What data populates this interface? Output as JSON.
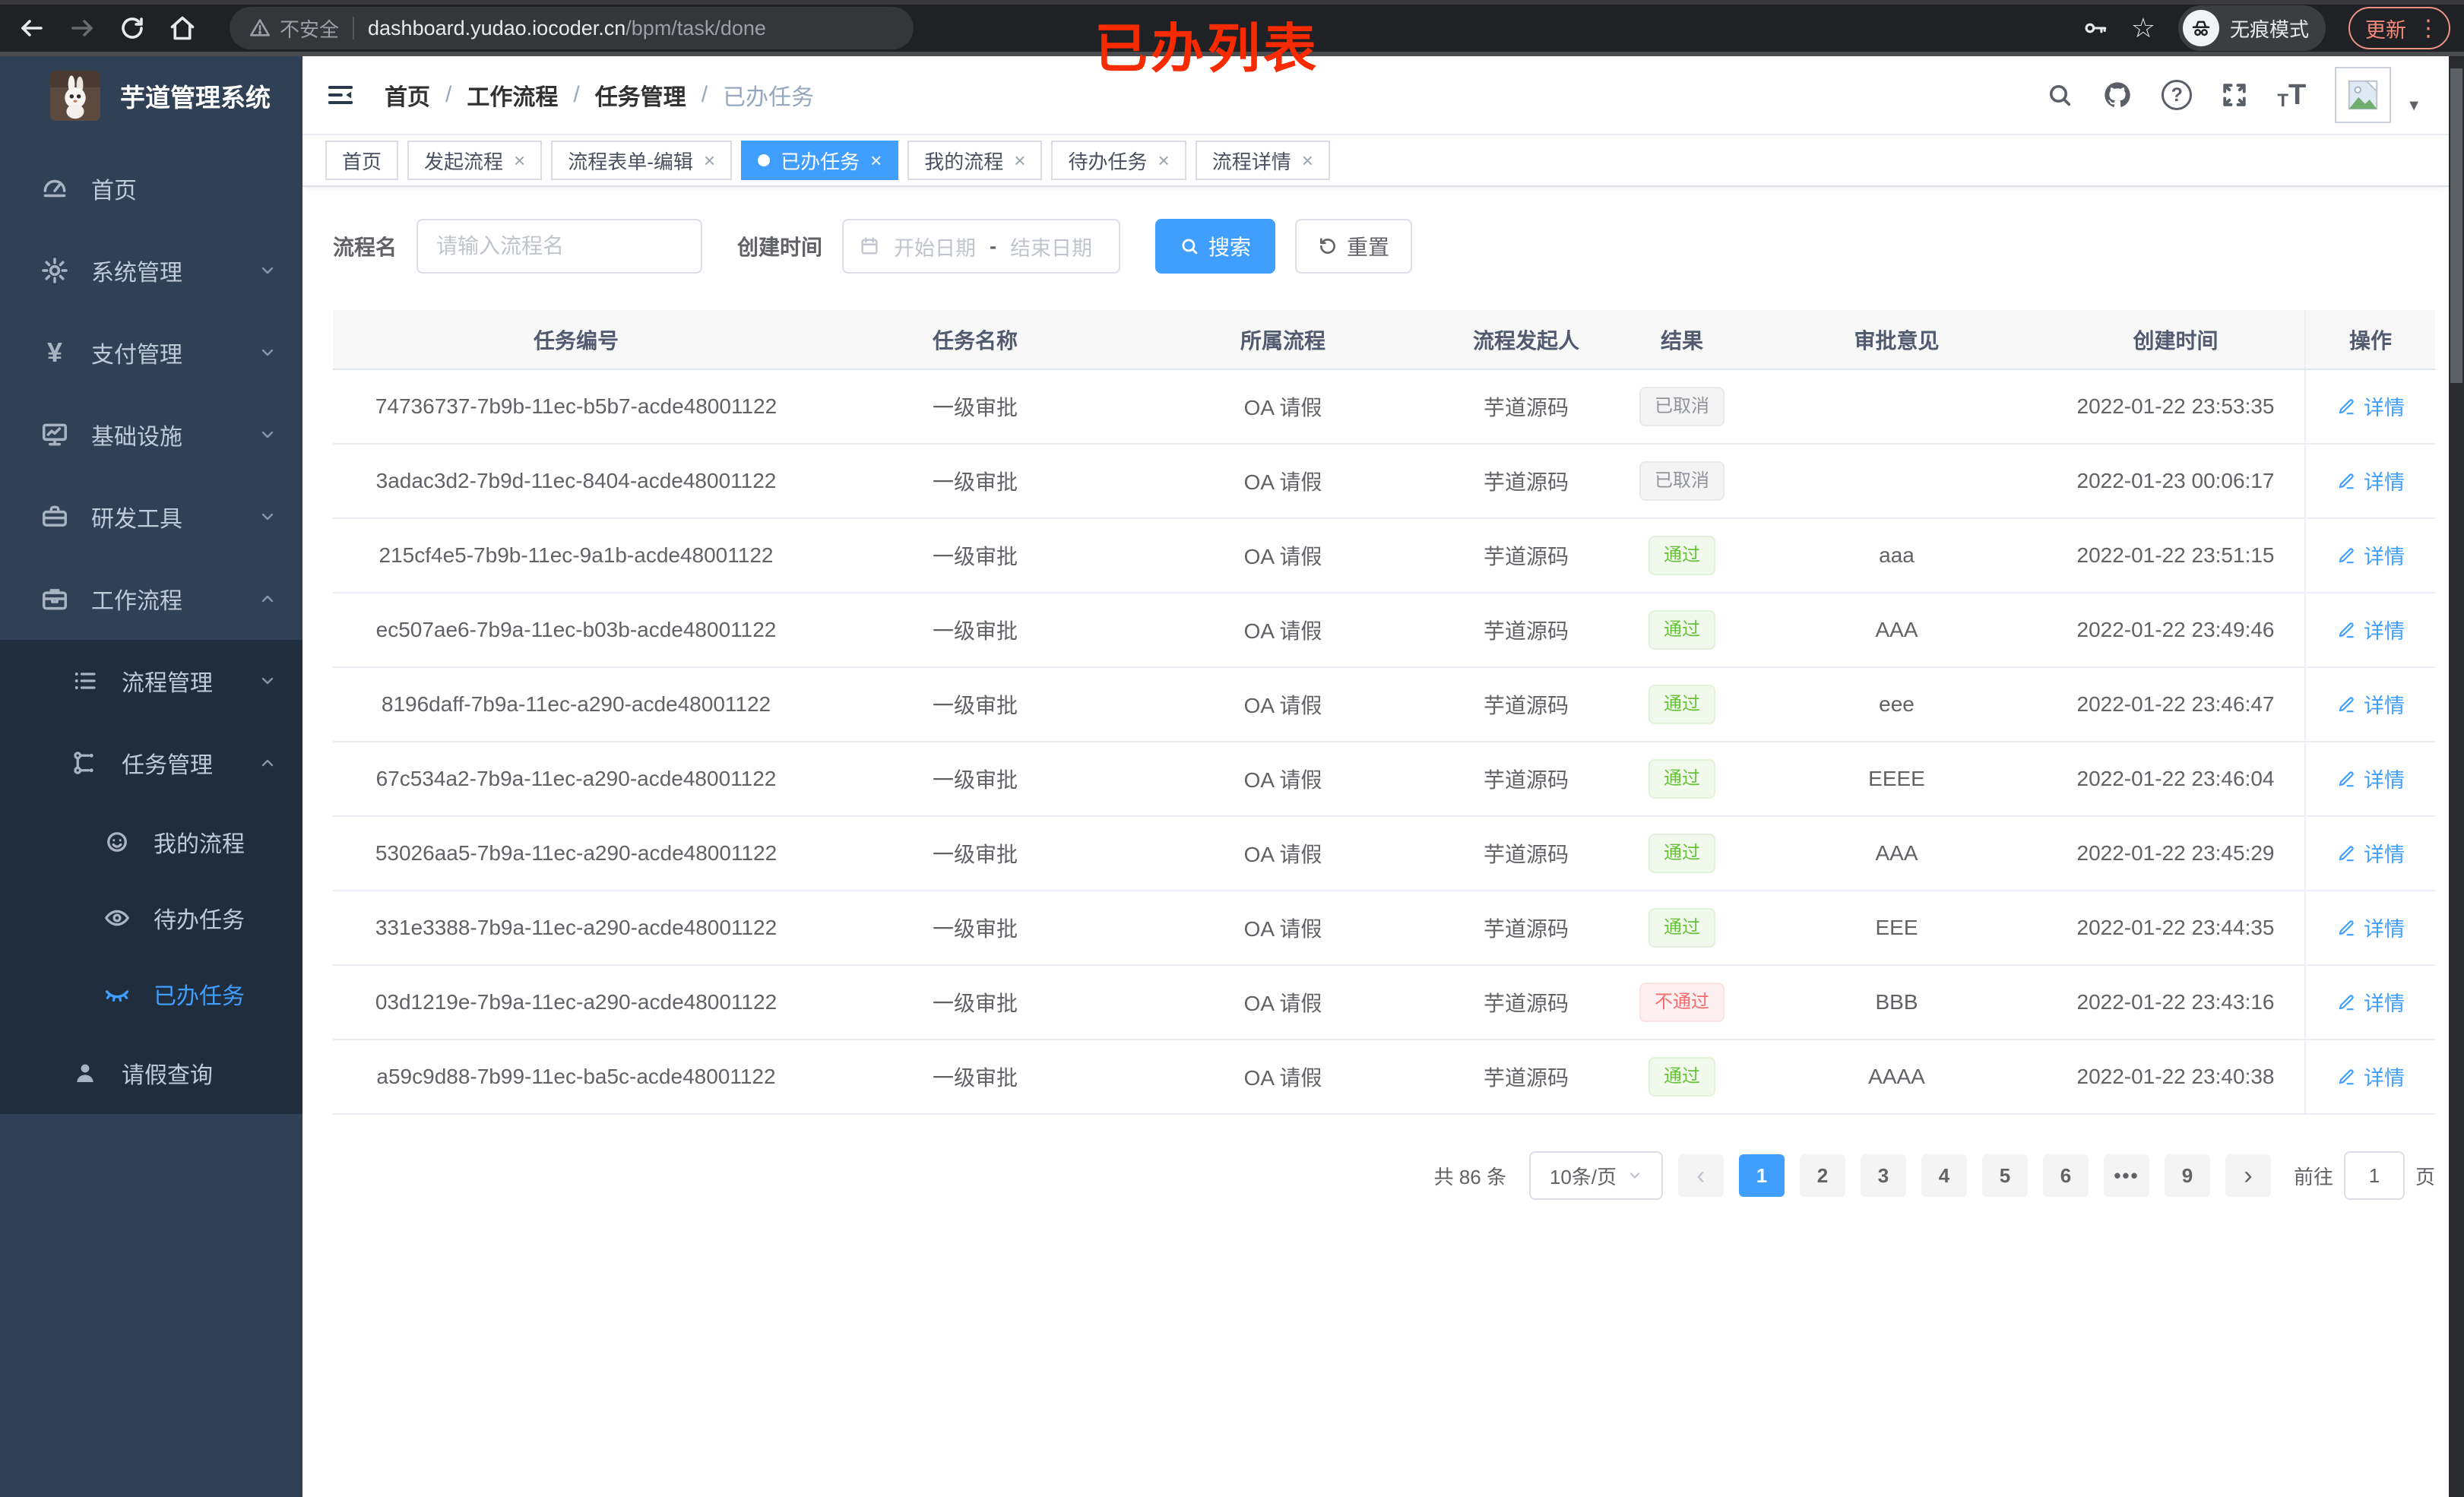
{
  "browser": {
    "security_label": "不安全",
    "url_host": "dashboard.yudao.iocoder.cn",
    "url_path": "/bpm/task/done",
    "incognito_label": "无痕模式",
    "update_label": "更新"
  },
  "annotation": {
    "text": "已办列表"
  },
  "sidebar": {
    "title": "芋道管理系统",
    "items": {
      "home": "首页",
      "system": "系统管理",
      "pay": "支付管理",
      "infra": "基础设施",
      "dev": "研发工具",
      "workflow": "工作流程",
      "process_mgmt": "流程管理",
      "task_mgmt": "任务管理",
      "my_process": "我的流程",
      "todo_task": "待办任务",
      "done_task": "已办任务",
      "leave_query": "请假查询"
    }
  },
  "header": {
    "breadcrumb": [
      "首页",
      "工作流程",
      "任务管理",
      "已办任务"
    ]
  },
  "tabs": [
    {
      "label": "首页",
      "closable": false,
      "active": false
    },
    {
      "label": "发起流程",
      "closable": true,
      "active": false
    },
    {
      "label": "流程表单-编辑",
      "closable": true,
      "active": false
    },
    {
      "label": "已办任务",
      "closable": true,
      "active": true
    },
    {
      "label": "我的流程",
      "closable": true,
      "active": false
    },
    {
      "label": "待办任务",
      "closable": true,
      "active": false
    },
    {
      "label": "流程详情",
      "closable": true,
      "active": false
    }
  ],
  "filters": {
    "name_label": "流程名",
    "name_placeholder": "请输入流程名",
    "time_label": "创建时间",
    "start_placeholder": "开始日期",
    "range_separator": "-",
    "end_placeholder": "结束日期",
    "search_label": "搜索",
    "reset_label": "重置"
  },
  "table": {
    "headers": [
      "任务编号",
      "任务名称",
      "所属流程",
      "流程发起人",
      "结果",
      "审批意见",
      "创建时间",
      "操作"
    ],
    "action_label": "详情",
    "rows": [
      {
        "id": "74736737-7b9b-11ec-b5b7-acde48001122",
        "name": "一级审批",
        "process": "OA 请假",
        "starter": "芋道源码",
        "result": "已取消",
        "result_type": "info",
        "opinion": "",
        "created": "2022-01-22 23:53:35"
      },
      {
        "id": "3adac3d2-7b9d-11ec-8404-acde48001122",
        "name": "一级审批",
        "process": "OA 请假",
        "starter": "芋道源码",
        "result": "已取消",
        "result_type": "info",
        "opinion": "",
        "created": "2022-01-23 00:06:17"
      },
      {
        "id": "215cf4e5-7b9b-11ec-9a1b-acde48001122",
        "name": "一级审批",
        "process": "OA 请假",
        "starter": "芋道源码",
        "result": "通过",
        "result_type": "success",
        "opinion": "aaa",
        "created": "2022-01-22 23:51:15"
      },
      {
        "id": "ec507ae6-7b9a-11ec-b03b-acde48001122",
        "name": "一级审批",
        "process": "OA 请假",
        "starter": "芋道源码",
        "result": "通过",
        "result_type": "success",
        "opinion": "AAA",
        "created": "2022-01-22 23:49:46"
      },
      {
        "id": "8196daff-7b9a-11ec-a290-acde48001122",
        "name": "一级审批",
        "process": "OA 请假",
        "starter": "芋道源码",
        "result": "通过",
        "result_type": "success",
        "opinion": "eee",
        "created": "2022-01-22 23:46:47"
      },
      {
        "id": "67c534a2-7b9a-11ec-a290-acde48001122",
        "name": "一级审批",
        "process": "OA 请假",
        "starter": "芋道源码",
        "result": "通过",
        "result_type": "success",
        "opinion": "EEEE",
        "created": "2022-01-22 23:46:04"
      },
      {
        "id": "53026aa5-7b9a-11ec-a290-acde48001122",
        "name": "一级审批",
        "process": "OA 请假",
        "starter": "芋道源码",
        "result": "通过",
        "result_type": "success",
        "opinion": "AAA",
        "created": "2022-01-22 23:45:29"
      },
      {
        "id": "331e3388-7b9a-11ec-a290-acde48001122",
        "name": "一级审批",
        "process": "OA 请假",
        "starter": "芋道源码",
        "result": "通过",
        "result_type": "success",
        "opinion": "EEE",
        "created": "2022-01-22 23:44:35"
      },
      {
        "id": "03d1219e-7b9a-11ec-a290-acde48001122",
        "name": "一级审批",
        "process": "OA 请假",
        "starter": "芋道源码",
        "result": "不通过",
        "result_type": "danger",
        "opinion": "BBB",
        "created": "2022-01-22 23:43:16"
      },
      {
        "id": "a59c9d88-7b99-11ec-ba5c-acde48001122",
        "name": "一级审批",
        "process": "OA 请假",
        "starter": "芋道源码",
        "result": "通过",
        "result_type": "success",
        "opinion": "AAAA",
        "created": "2022-01-22 23:40:38"
      }
    ]
  },
  "pagination": {
    "total": "共 86 条",
    "page_size": "10条/页",
    "pages": [
      "1",
      "2",
      "3",
      "4",
      "5",
      "6",
      "•••",
      "9"
    ],
    "active_page": "1",
    "goto_label": "前往",
    "goto_value": "1",
    "page_unit": "页"
  },
  "colors": {
    "accent": "#409eff",
    "success": "#67c23a",
    "danger": "#f56c6c",
    "info": "#909399",
    "sidebar": "#304156",
    "submenu": "#1f2d3d"
  }
}
